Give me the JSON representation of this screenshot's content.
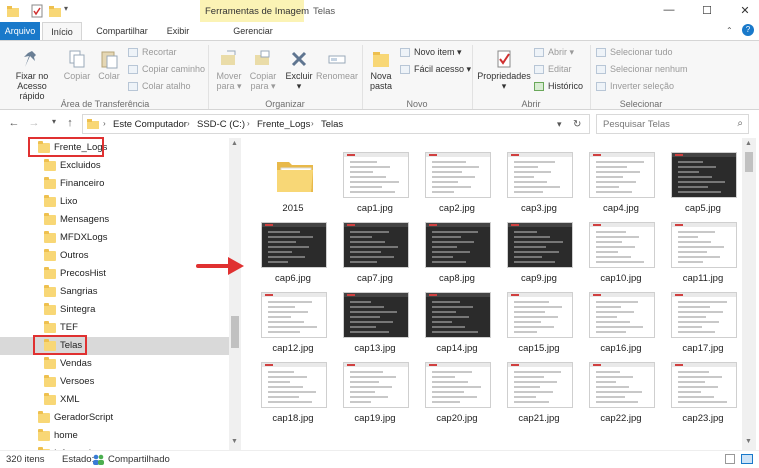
{
  "window": {
    "context_tab": "Ferramentas de Imagem",
    "title": "Telas",
    "controls": [
      "minimize-icon",
      "maximize-icon",
      "close-icon"
    ]
  },
  "tabs": [
    "Arquivo",
    "Início",
    "Compartilhar",
    "Exibir",
    "Gerenciar"
  ],
  "ribbon": {
    "clipboard": {
      "pin": "Fixar no Acesso rápido",
      "copy": "Copiar",
      "paste": "Colar",
      "cut": "Recortar",
      "copy_path": "Copiar caminho",
      "paste_shortcut": "Colar atalho",
      "group": "Área de Transferência"
    },
    "organize": {
      "move": "Mover para",
      "copy_to": "Copiar para",
      "delete": "Excluir",
      "rename": "Renomear",
      "group": "Organizar"
    },
    "new": {
      "new_folder": "Nova pasta",
      "new_item": "Novo item",
      "easy_access": "Fácil acesso",
      "group": "Novo"
    },
    "open": {
      "properties": "Propriedades",
      "open": "Abrir",
      "edit": "Editar",
      "history": "Histórico",
      "group": "Abrir"
    },
    "select": {
      "select_all": "Selecionar tudo",
      "select_none": "Selecionar nenhum",
      "invert": "Inverter seleção",
      "group": "Selecionar"
    }
  },
  "address": {
    "crumbs": [
      "Este Computador",
      "SSD-C (C:)",
      "Frente_Logs",
      "Telas"
    ],
    "search_placeholder": "Pesquisar Telas"
  },
  "nav": {
    "items": [
      {
        "label": "Frente_Logs",
        "level": 0
      },
      {
        "label": "Excluidos",
        "level": 1
      },
      {
        "label": "Financeiro",
        "level": 1
      },
      {
        "label": "Lixo",
        "level": 1
      },
      {
        "label": "Mensagens",
        "level": 1
      },
      {
        "label": "MFDXLogs",
        "level": 1
      },
      {
        "label": "Outros",
        "level": 1
      },
      {
        "label": "PrecosHist",
        "level": 1
      },
      {
        "label": "Sangrias",
        "level": 1
      },
      {
        "label": "Sintegra",
        "level": 1
      },
      {
        "label": "TEF",
        "level": 1
      },
      {
        "label": "Telas",
        "level": 1,
        "selected": true
      },
      {
        "label": "Vendas",
        "level": 1
      },
      {
        "label": "Versoes",
        "level": 1
      },
      {
        "label": "XML",
        "level": 1
      },
      {
        "label": "GeradorScript",
        "level": 0
      },
      {
        "label": "home",
        "level": 0
      },
      {
        "label": "Informatica",
        "level": 0
      }
    ]
  },
  "files": [
    {
      "name": "2015",
      "kind": "folder"
    },
    {
      "name": "cap1.jpg",
      "kind": "light"
    },
    {
      "name": "cap2.jpg",
      "kind": "light"
    },
    {
      "name": "cap3.jpg",
      "kind": "light"
    },
    {
      "name": "cap4.jpg",
      "kind": "light"
    },
    {
      "name": "cap5.jpg",
      "kind": "dark"
    },
    {
      "name": "cap6.jpg",
      "kind": "dark"
    },
    {
      "name": "cap7.jpg",
      "kind": "dark"
    },
    {
      "name": "cap8.jpg",
      "kind": "dark"
    },
    {
      "name": "cap9.jpg",
      "kind": "dark"
    },
    {
      "name": "cap10.jpg",
      "kind": "light"
    },
    {
      "name": "cap11.jpg",
      "kind": "light"
    },
    {
      "name": "cap12.jpg",
      "kind": "light"
    },
    {
      "name": "cap13.jpg",
      "kind": "dark"
    },
    {
      "name": "cap14.jpg",
      "kind": "dark"
    },
    {
      "name": "cap15.jpg",
      "kind": "light"
    },
    {
      "name": "cap16.jpg",
      "kind": "light"
    },
    {
      "name": "cap17.jpg",
      "kind": "light"
    },
    {
      "name": "cap18.jpg",
      "kind": "light"
    },
    {
      "name": "cap19.jpg",
      "kind": "light"
    },
    {
      "name": "cap20.jpg",
      "kind": "light"
    },
    {
      "name": "cap21.jpg",
      "kind": "light"
    },
    {
      "name": "cap22.jpg",
      "kind": "light"
    },
    {
      "name": "cap23.jpg",
      "kind": "light"
    }
  ],
  "status": {
    "count": "320 itens",
    "state_label": "Estado:",
    "state_value": "Compartilhado"
  },
  "colors": {
    "accent": "#1979ca",
    "highlight": "#e03131",
    "context_tab": "#fbf3b5"
  }
}
